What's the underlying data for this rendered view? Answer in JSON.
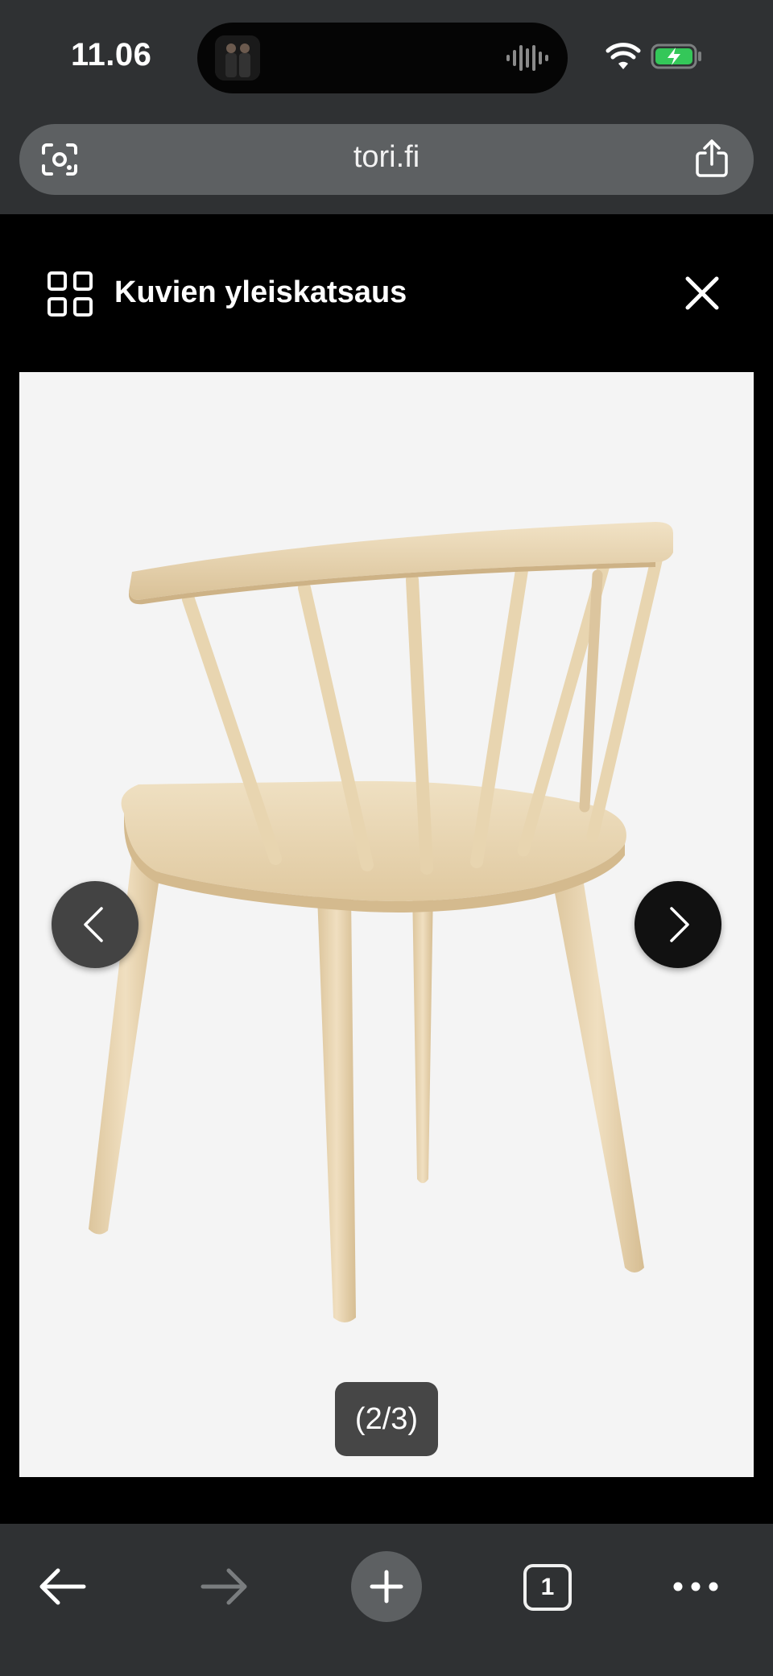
{
  "status_bar": {
    "time": "11.06",
    "icons": [
      "wifi-icon",
      "battery-charging-icon"
    ],
    "battery_color": "#34c759"
  },
  "browser": {
    "url": "tori.fi",
    "icons": [
      "lens-icon",
      "share-icon"
    ]
  },
  "gallery": {
    "title": "Kuvien yleiskatsaus",
    "counter": "(2/3)",
    "current_image": 2,
    "total_images": 3,
    "icons": [
      "grid-icon",
      "close-icon",
      "chevron-left-icon",
      "chevron-right-icon"
    ]
  },
  "toolbar": {
    "tab_count": "1",
    "icons": [
      "back-arrow-icon",
      "forward-arrow-icon",
      "plus-icon",
      "tabs-icon",
      "more-icon"
    ]
  },
  "colors": {
    "chrome_bg": "#2f3133",
    "field_bg": "#5d6062",
    "photo_bg": "#f4f4f4",
    "wood": "#e6d2ae"
  }
}
